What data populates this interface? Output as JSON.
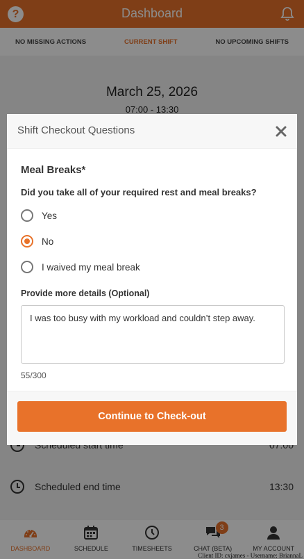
{
  "header": {
    "title": "Dashboard"
  },
  "tabs": [
    {
      "label": "NO MISSING ACTIONS"
    },
    {
      "label": "CURRENT SHIFT"
    },
    {
      "label": "NO UPCOMING SHIFTS"
    }
  ],
  "shift": {
    "date": "March 25, 2026",
    "time_range": "07:00 - 13:30",
    "scheduled_start_label": "Scheduled start time",
    "scheduled_start_value": "07:00",
    "scheduled_end_label": "Scheduled end time",
    "scheduled_end_value": "13:30"
  },
  "modal": {
    "title": "Shift Checkout Questions",
    "section_title": "Meal Breaks*",
    "question": "Did you take all of your required rest and meal breaks?",
    "options": [
      {
        "label": "Yes",
        "selected": false
      },
      {
        "label": "No",
        "selected": true
      },
      {
        "label": "I waived my meal break",
        "selected": false
      }
    ],
    "details_label": "Provide more details (Optional)",
    "details_value": "I was too busy with my workload and couldn’t step away.",
    "char_count": "55/300",
    "continue_label": "Continue to Check-out"
  },
  "bottom_nav": [
    {
      "label": "DASHBOARD",
      "icon": "dashboard-icon"
    },
    {
      "label": "SCHEDULE",
      "icon": "calendar-icon"
    },
    {
      "label": "TIMESHEETS",
      "icon": "clock-icon"
    },
    {
      "label": "CHAT (BETA)",
      "icon": "chat-icon",
      "badge": "3"
    },
    {
      "label": "MY ACCOUNT",
      "icon": "user-icon"
    }
  ],
  "footer_note": "Client ID: cxjames - Username: BriannaL",
  "colors": {
    "accent": "#e8722a",
    "overlay": "rgba(0,0,0,0.45)"
  }
}
